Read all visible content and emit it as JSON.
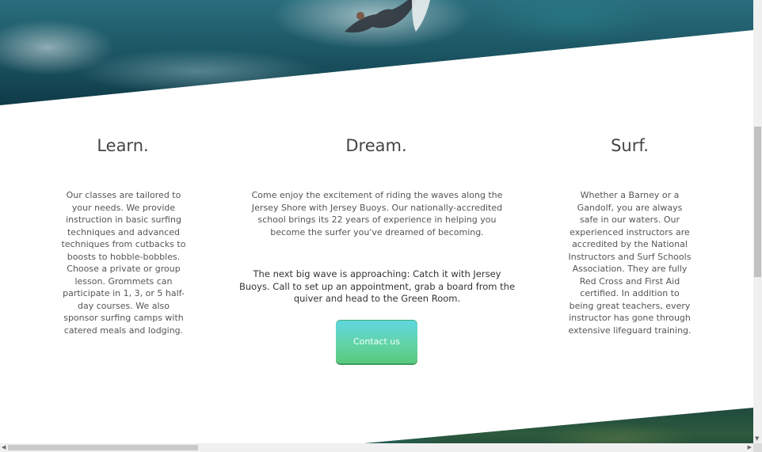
{
  "hero": {
    "image_name": "surfer-wave-image"
  },
  "columns": {
    "learn": {
      "title": "Learn.",
      "text": "Our classes are tailored to your needs. We provide instruction in basic surfing techniques and advanced techniques from cutbacks to boosts to hobble-bobbles. Choose a private or group lesson. Grommets can participate in 1, 3, or 5 half-day courses. We also sponsor surfing camps with catered meals and lodging."
    },
    "dream": {
      "title": "Dream.",
      "text": "Come enjoy the excitement of riding the waves along the Jersey Shore with Jersey Buoys. Our nationally-accredited school brings its 22 years of experience in helping you become the surfer you've dreamed of becoming.",
      "cta": "The next big wave is approaching: Catch it with Jersey Buoys. Call to set up an appointment, grab a board from the quiver and head to the Green Room.",
      "button_label": "Contact us"
    },
    "surf": {
      "title": "Surf.",
      "text": "Whether a Barney or a Gandolf, you are always safe in our waters. Our experienced instructors are accredited by the National Instructors and Surf Schools Association. They are fully Red Cross and First Aid certified. In addition to being great teachers, every instructor has gone through extensive lifeguard training."
    }
  },
  "colors": {
    "button_top": "#5fd6e2",
    "button_bottom": "#58c97d",
    "heading": "#444444",
    "hero_water": "#1e5a68"
  },
  "scrollbars": {
    "up_icon": "scroll-up-icon",
    "down_icon": "scroll-down-icon",
    "left_icon": "scroll-left-icon",
    "right_icon": "scroll-right-icon"
  }
}
